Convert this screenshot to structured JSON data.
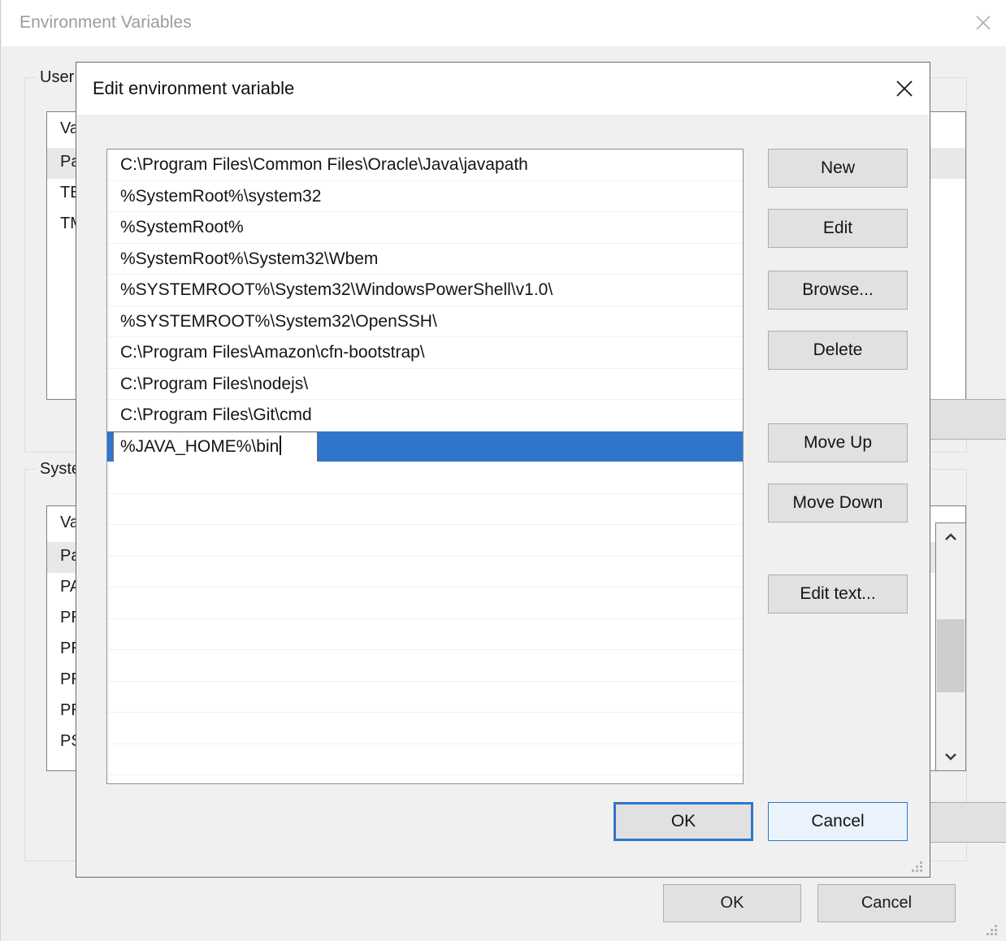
{
  "parent_window": {
    "title": "Environment Variables",
    "close_icon": "close-icon",
    "user_group": {
      "label": "User",
      "column_header": "Va",
      "rows": [
        "Pa",
        "TE",
        "TM"
      ]
    },
    "system_group": {
      "label": "Syste",
      "column_header": "Va",
      "rows": [
        "Pa",
        "PA",
        "PR",
        "PR",
        "PR",
        "PR",
        "PS"
      ]
    },
    "scrollbar": {
      "up_icon": "chevron-up-icon",
      "down_icon": "chevron-down-icon"
    },
    "buttons": {
      "ok": "OK",
      "cancel": "Cancel"
    }
  },
  "dialog": {
    "title": "Edit environment variable",
    "close_icon": "close-icon",
    "path_entries": [
      "C:\\Program Files\\Common Files\\Oracle\\Java\\javapath",
      "%SystemRoot%\\system32",
      "%SystemRoot%",
      "%SystemRoot%\\System32\\Wbem",
      "%SYSTEMROOT%\\System32\\WindowsPowerShell\\v1.0\\",
      "%SYSTEMROOT%\\System32\\OpenSSH\\",
      "C:\\Program Files\\Amazon\\cfn-bootstrap\\",
      "C:\\Program Files\\nodejs\\",
      "C:\\Program Files\\Git\\cmd"
    ],
    "editing_row": {
      "value": "%JAVA_HOME%\\bin",
      "highlight_color": "#2f76cb"
    },
    "empty_row_count": 11,
    "side_buttons": {
      "new": "New",
      "edit": "Edit",
      "browse": "Browse...",
      "delete": "Delete",
      "move_up": "Move Up",
      "move_down": "Move Down",
      "edit_text": "Edit text..."
    },
    "footer_buttons": {
      "ok": "OK",
      "cancel": "Cancel"
    },
    "accent_color": "#2f76cb"
  }
}
